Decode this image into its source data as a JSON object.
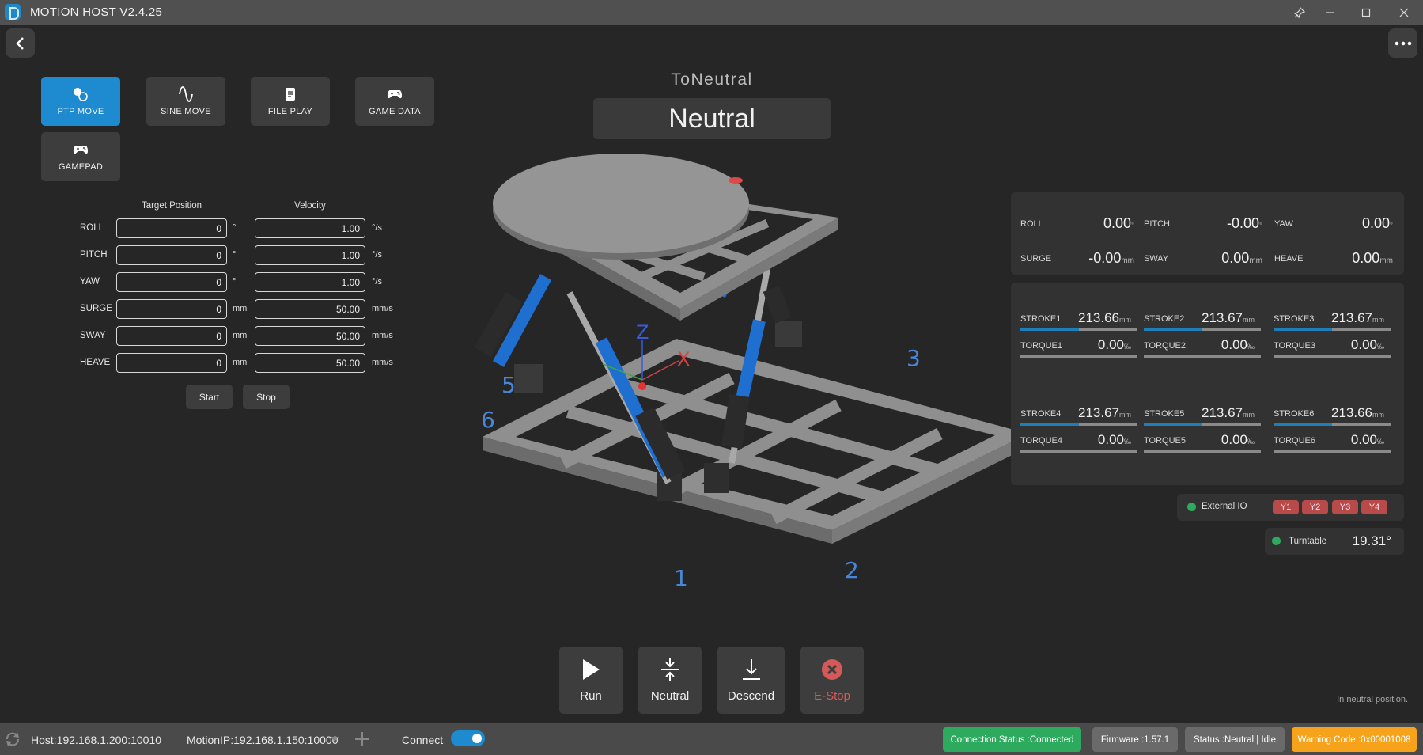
{
  "titlebar": {
    "title": "MOTION HOST V2.4.25"
  },
  "modes": [
    {
      "label": "PTP MOVE",
      "icon": "ptp-icon",
      "active": true
    },
    {
      "label": "SINE MOVE",
      "icon": "sine-wave-icon",
      "active": false
    },
    {
      "label": "FILE PLAY",
      "icon": "file-icon",
      "active": false
    },
    {
      "label": "GAME DATA",
      "icon": "gamepad-icon",
      "active": false
    },
    {
      "label": "GAMEPAD",
      "icon": "gamepad-icon",
      "active": false
    }
  ],
  "form": {
    "target_header": "Target Position",
    "velocity_header": "Velocity",
    "rows": [
      {
        "label": "ROLL",
        "target": "0",
        "unit": "°",
        "velocity": "1.00",
        "vunit": "°/s"
      },
      {
        "label": "PITCH",
        "target": "0",
        "unit": "°",
        "velocity": "1.00",
        "vunit": "°/s"
      },
      {
        "label": "YAW",
        "target": "0",
        "unit": "°",
        "velocity": "1.00",
        "vunit": "°/s"
      },
      {
        "label": "SURGE",
        "target": "0",
        "unit": "mm",
        "velocity": "50.00",
        "vunit": "mm/s"
      },
      {
        "label": "SWAY",
        "target": "0",
        "unit": "mm",
        "velocity": "50.00",
        "vunit": "mm/s"
      },
      {
        "label": "HEAVE",
        "target": "0",
        "unit": "mm",
        "velocity": "50.00",
        "vunit": "mm/s"
      }
    ],
    "start_label": "Start",
    "stop_label": "Stop"
  },
  "state": {
    "sub": "ToNeutral",
    "main": "Neutral"
  },
  "scene": {
    "axis_labels": [
      "Z",
      "X"
    ],
    "actuator_numbers": [
      "1",
      "2",
      "3",
      "5",
      "6"
    ]
  },
  "pose": [
    {
      "label": "ROLL",
      "value": "0.00",
      "unit": "°"
    },
    {
      "label": "PITCH",
      "value": "-0.00",
      "unit": "°"
    },
    {
      "label": "YAW",
      "value": "0.00",
      "unit": "°"
    },
    {
      "label": "SURGE",
      "value": "-0.00",
      "unit": "mm"
    },
    {
      "label": "SWAY",
      "value": "0.00",
      "unit": "mm"
    },
    {
      "label": "HEAVE",
      "value": "0.00",
      "unit": "mm"
    }
  ],
  "actuators": [
    {
      "stroke_label": "STROKE1",
      "stroke": "213.66",
      "torque_label": "TORQUE1",
      "torque": "0.00",
      "level": 0.5
    },
    {
      "stroke_label": "STROKE2",
      "stroke": "213.67",
      "torque_label": "TORQUE2",
      "torque": "0.00",
      "level": 0.5
    },
    {
      "stroke_label": "STROKE3",
      "stroke": "213.67",
      "torque_label": "TORQUE3",
      "torque": "0.00",
      "level": 0.5
    },
    {
      "stroke_label": "STROKE4",
      "stroke": "213.67",
      "torque_label": "TORQUE4",
      "torque": "0.00",
      "level": 0.5
    },
    {
      "stroke_label": "STROKE5",
      "stroke": "213.67",
      "torque_label": "TORQUE5",
      "torque": "0.00",
      "level": 0.5
    },
    {
      "stroke_label": "STROKE6",
      "stroke": "213.66",
      "torque_label": "TORQUE6",
      "torque": "0.00",
      "level": 0.5
    }
  ],
  "units": {
    "stroke": "mm",
    "torque": "‰"
  },
  "external_io": {
    "label": "External IO",
    "outputs": [
      "Y1",
      "Y2",
      "Y3",
      "Y4"
    ]
  },
  "turntable": {
    "label": "Turntable",
    "value": "19.31°"
  },
  "actions": {
    "run": "Run",
    "neutral": "Neutral",
    "descend": "Descend",
    "estop": "E-Stop"
  },
  "message": "In neutral position.",
  "statusbar": {
    "host": "Host:192.168.1.200:10010",
    "motion_ip": "MotionIP:192.168.1.150:10000",
    "connect_label": "Connect",
    "connection_status": "Connection Status :Connected",
    "firmware": "Firmware :1.57.1",
    "status": "Status :Neutral | Idle",
    "warning": "Warning Code :0x00001008"
  },
  "colors": {
    "accent": "#1e8bd0",
    "connected": "#2eaa5e",
    "warning": "#f7a21b",
    "estop": "#d45a5a"
  }
}
